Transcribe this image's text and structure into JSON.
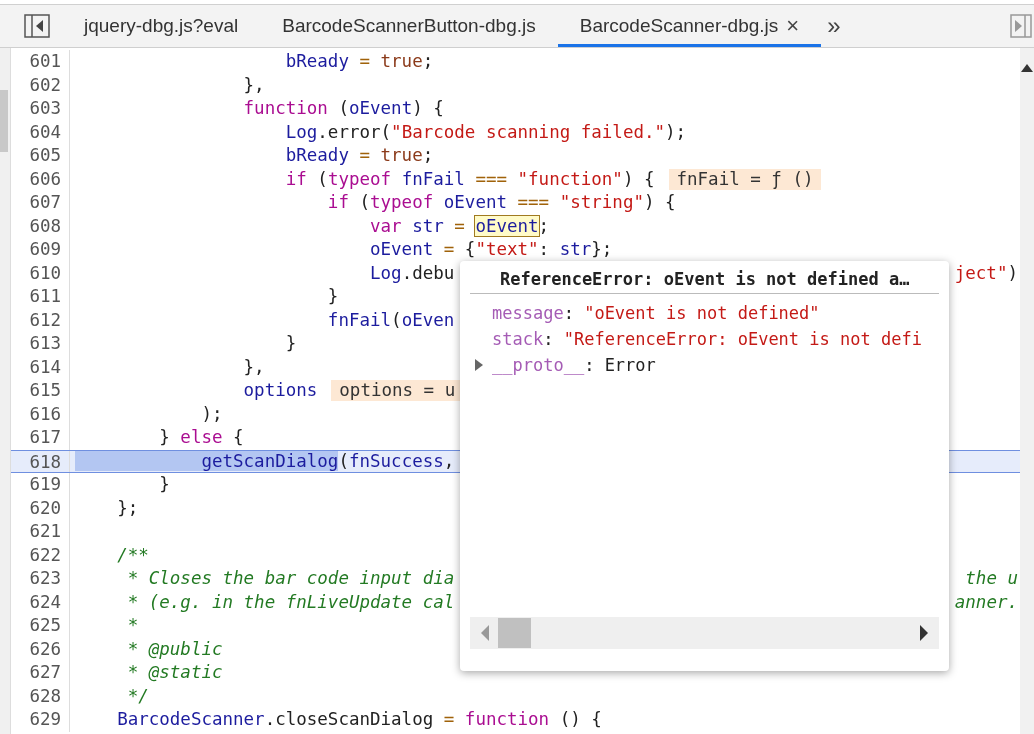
{
  "tabs": [
    {
      "label": "jquery-dbg.js?eval",
      "selected": false,
      "closable": false
    },
    {
      "label": "BarcodeScannerButton-dbg.js",
      "selected": false,
      "closable": false
    },
    {
      "label": "BarcodeScanner-dbg.js",
      "selected": true,
      "closable": true
    }
  ],
  "more_tabs": "»",
  "close_icon": "×",
  "lines": [
    {
      "number": "601",
      "current": false,
      "tokens": [
        {
          "kind": "name",
          "text": "                    bReady"
        },
        {
          "kind": "operator",
          "text": " = "
        },
        {
          "kind": "literal",
          "text": "true"
        },
        {
          "kind": "plain",
          "text": ";"
        }
      ]
    },
    {
      "number": "602",
      "current": false,
      "tokens": [
        {
          "kind": "plain",
          "text": "                },"
        }
      ]
    },
    {
      "number": "603",
      "current": false,
      "tokens": [
        {
          "kind": "keyword",
          "text": "                function"
        },
        {
          "kind": "plain",
          "text": " ("
        },
        {
          "kind": "name",
          "text": "oEvent"
        },
        {
          "kind": "plain",
          "text": ") {"
        }
      ]
    },
    {
      "number": "604",
      "current": false,
      "tokens": [
        {
          "kind": "name",
          "text": "                    Log"
        },
        {
          "kind": "plain",
          "text": ".error("
        },
        {
          "kind": "string",
          "text": "\"Barcode scanning failed.\""
        },
        {
          "kind": "plain",
          "text": ");"
        }
      ]
    },
    {
      "number": "605",
      "current": false,
      "tokens": [
        {
          "kind": "name",
          "text": "                    bReady"
        },
        {
          "kind": "operator",
          "text": " = "
        },
        {
          "kind": "literal",
          "text": "true"
        },
        {
          "kind": "plain",
          "text": ";"
        }
      ]
    },
    {
      "number": "606",
      "current": false,
      "tokens": [
        {
          "kind": "keyword",
          "text": "                    if"
        },
        {
          "kind": "plain",
          "text": " ("
        },
        {
          "kind": "keyword",
          "text": "typeof"
        },
        {
          "kind": "name",
          "text": " fnFail"
        },
        {
          "kind": "operator",
          "text": " === "
        },
        {
          "kind": "string",
          "text": "\"function\""
        },
        {
          "kind": "plain",
          "text": ") {"
        }
      ],
      "inline": "fnFail = ƒ ()"
    },
    {
      "number": "607",
      "current": false,
      "tokens": [
        {
          "kind": "keyword",
          "text": "                        if"
        },
        {
          "kind": "plain",
          "text": " ("
        },
        {
          "kind": "keyword",
          "text": "typeof"
        },
        {
          "kind": "name",
          "text": " oEvent"
        },
        {
          "kind": "operator",
          "text": " === "
        },
        {
          "kind": "string",
          "text": "\"string\""
        },
        {
          "kind": "plain",
          "text": ") {"
        }
      ]
    },
    {
      "number": "608",
      "current": false,
      "tokens": [
        {
          "kind": "keyword",
          "text": "                            var"
        },
        {
          "kind": "name",
          "text": " str"
        },
        {
          "kind": "operator",
          "text": " = "
        },
        {
          "kind": "hover",
          "text": "oEvent"
        },
        {
          "kind": "plain",
          "text": ";"
        }
      ]
    },
    {
      "number": "609",
      "current": false,
      "tokens": [
        {
          "kind": "name",
          "text": "                            oEvent"
        },
        {
          "kind": "operator",
          "text": " = "
        },
        {
          "kind": "plain",
          "text": "{"
        },
        {
          "kind": "string",
          "text": "\"text\""
        },
        {
          "kind": "plain",
          "text": ": "
        },
        {
          "kind": "name",
          "text": "str"
        },
        {
          "kind": "plain",
          "text": "};"
        }
      ]
    },
    {
      "number": "610",
      "current": false,
      "tokens": [
        {
          "kind": "name",
          "text": "                            Log"
        },
        {
          "kind": "plain",
          "text": ".debu"
        }
      ],
      "tail": [
        {
          "kind": "string",
          "text": "ject\""
        },
        {
          "kind": "plain",
          "text": ")"
        }
      ]
    },
    {
      "number": "611",
      "current": false,
      "tokens": [
        {
          "kind": "plain",
          "text": "                        }"
        }
      ]
    },
    {
      "number": "612",
      "current": false,
      "tokens": [
        {
          "kind": "name",
          "text": "                        fnFail"
        },
        {
          "kind": "plain",
          "text": "("
        },
        {
          "kind": "name",
          "text": "oEven"
        }
      ]
    },
    {
      "number": "613",
      "current": false,
      "tokens": [
        {
          "kind": "plain",
          "text": "                    }"
        }
      ]
    },
    {
      "number": "614",
      "current": false,
      "tokens": [
        {
          "kind": "plain",
          "text": "                },"
        }
      ]
    },
    {
      "number": "615",
      "current": false,
      "tokens": [
        {
          "kind": "name",
          "text": "                options"
        }
      ],
      "inline": "options = u"
    },
    {
      "number": "616",
      "current": false,
      "tokens": [
        {
          "kind": "plain",
          "text": "            );"
        }
      ]
    },
    {
      "number": "617",
      "current": false,
      "tokens": [
        {
          "kind": "plain",
          "text": "        } "
        },
        {
          "kind": "keyword",
          "text": "else"
        },
        {
          "kind": "plain",
          "text": " {"
        }
      ]
    },
    {
      "number": "618",
      "current": true,
      "tokens": [
        {
          "kind": "selected",
          "text": "            getScanDialog"
        },
        {
          "kind": "plain",
          "text": "("
        },
        {
          "kind": "name",
          "text": "fnSuccess"
        },
        {
          "kind": "plain",
          "text": ","
        }
      ]
    },
    {
      "number": "619",
      "current": false,
      "tokens": [
        {
          "kind": "plain",
          "text": "        }"
        }
      ]
    },
    {
      "number": "620",
      "current": false,
      "tokens": [
        {
          "kind": "plain",
          "text": "    };"
        }
      ]
    },
    {
      "number": "621",
      "current": false
    },
    {
      "number": "622",
      "current": false,
      "tokens": [
        {
          "kind": "comment",
          "text": "    /**"
        }
      ]
    },
    {
      "number": "623",
      "current": false,
      "tokens": [
        {
          "kind": "comment",
          "text": "     * Closes the bar code input dia"
        }
      ],
      "tail": [
        {
          "kind": "comment",
          "text": "the u"
        }
      ]
    },
    {
      "number": "624",
      "current": false,
      "tokens": [
        {
          "kind": "comment",
          "text": "     * (e.g. in the fnLiveUpdate cal"
        }
      ],
      "tail": [
        {
          "kind": "comment",
          "text": "anner."
        }
      ]
    },
    {
      "number": "625",
      "current": false,
      "tokens": [
        {
          "kind": "comment",
          "text": "     *"
        }
      ]
    },
    {
      "number": "626",
      "current": false,
      "tokens": [
        {
          "kind": "comment",
          "text": "     * @public"
        }
      ]
    },
    {
      "number": "627",
      "current": false,
      "tokens": [
        {
          "kind": "comment",
          "text": "     * @static"
        }
      ]
    },
    {
      "number": "628",
      "current": false,
      "tokens": [
        {
          "kind": "comment",
          "text": "     */"
        }
      ]
    },
    {
      "number": "629",
      "current": false,
      "tokens": [
        {
          "kind": "name",
          "text": "    BarcodeScanner"
        },
        {
          "kind": "plain",
          "text": ".closeScanDialog"
        },
        {
          "kind": "operator",
          "text": " = "
        },
        {
          "kind": "keyword",
          "text": "function"
        },
        {
          "kind": "plain",
          "text": " () {"
        }
      ]
    }
  ],
  "popup": {
    "title": "ReferenceError: oEvent is not defined a…",
    "properties": [
      {
        "key": "message",
        "separator": ":",
        "value": "\"oEvent is not defined\"",
        "kind": "string",
        "expandable": false
      },
      {
        "key": "stack",
        "separator": ":",
        "value": "\"ReferenceError: oEvent is not defi",
        "kind": "string",
        "expandable": false
      },
      {
        "key": "__proto__",
        "separator": ":",
        "value": "Error",
        "kind": "object",
        "expandable": true
      }
    ]
  }
}
